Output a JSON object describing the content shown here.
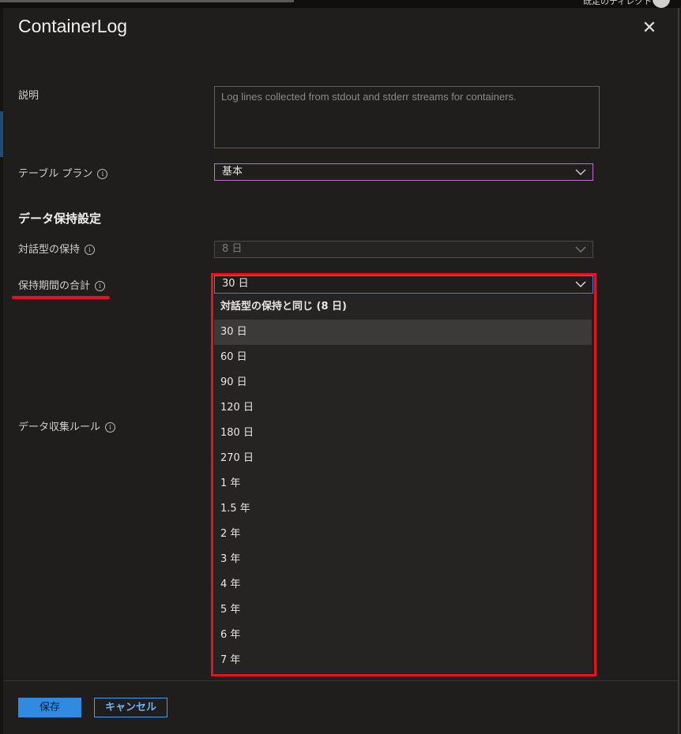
{
  "topbar": {
    "directory_label": "既定のディレクトリ"
  },
  "panel": {
    "title": "ContainerLog",
    "close_icon": "✕"
  },
  "form": {
    "description": {
      "label": "説明",
      "value": "Log lines collected from stdout and stderr streams for containers."
    },
    "table_plan": {
      "label": "テーブル プラン",
      "value": "基本"
    },
    "section_title": "データ保持設定",
    "interactive_retention": {
      "label": "対話型の保持",
      "value": "8 日"
    },
    "total_retention": {
      "label": "保持期間の合計",
      "value": "30 日",
      "options": [
        "対話型の保持と同じ (8 日)",
        "30 日",
        "60 日",
        "90 日",
        "120 日",
        "180 日",
        "270 日",
        "1 年",
        "1.5 年",
        "2 年",
        "3 年",
        "4 年",
        "5 年",
        "6 年",
        "7 年"
      ],
      "selected_index": 1
    },
    "dcr": {
      "label": "データ収集ルール"
    }
  },
  "footer": {
    "save_label": "保存",
    "cancel_label": "キャンセル"
  },
  "colors": {
    "accent": "#2f8ae0",
    "highlight_annotation": "#e8111e",
    "plan_border": "#c86bd0"
  }
}
